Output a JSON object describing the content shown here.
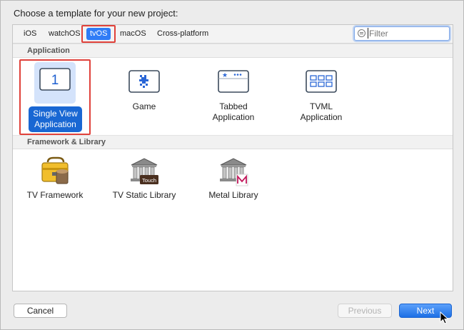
{
  "dialog": {
    "heading": "Choose a template for your new project:"
  },
  "tabs": [
    {
      "label": "iOS",
      "selected": false
    },
    {
      "label": "watchOS",
      "selected": false
    },
    {
      "label": "tvOS",
      "selected": true
    },
    {
      "label": "macOS",
      "selected": false
    },
    {
      "label": "Cross-platform",
      "selected": false
    }
  ],
  "filter": {
    "placeholder": "Filter",
    "value": ""
  },
  "sections": {
    "application": {
      "title": "Application",
      "items": [
        {
          "label": "Single View Application",
          "icon": "single-view-icon",
          "selected": true,
          "badge": "1"
        },
        {
          "label": "Game",
          "icon": "game-icon",
          "selected": false
        },
        {
          "label": "Tabbed Application",
          "icon": "tabbed-icon",
          "selected": false
        },
        {
          "label": "TVML Application",
          "icon": "tvml-icon",
          "selected": false
        }
      ]
    },
    "framework": {
      "title": "Framework & Library",
      "items": [
        {
          "label": "TV Framework",
          "icon": "toolbox-icon"
        },
        {
          "label": "TV Static Library",
          "icon": "library-building-icon",
          "badge": "Touch"
        },
        {
          "label": "Metal Library",
          "icon": "metal-library-icon"
        }
      ]
    }
  },
  "buttons": {
    "cancel": "Cancel",
    "previous": "Previous",
    "next": "Next"
  },
  "colors": {
    "accent": "#2f7cf6",
    "highlight": "#e0413a",
    "selection": "#1967d3"
  }
}
